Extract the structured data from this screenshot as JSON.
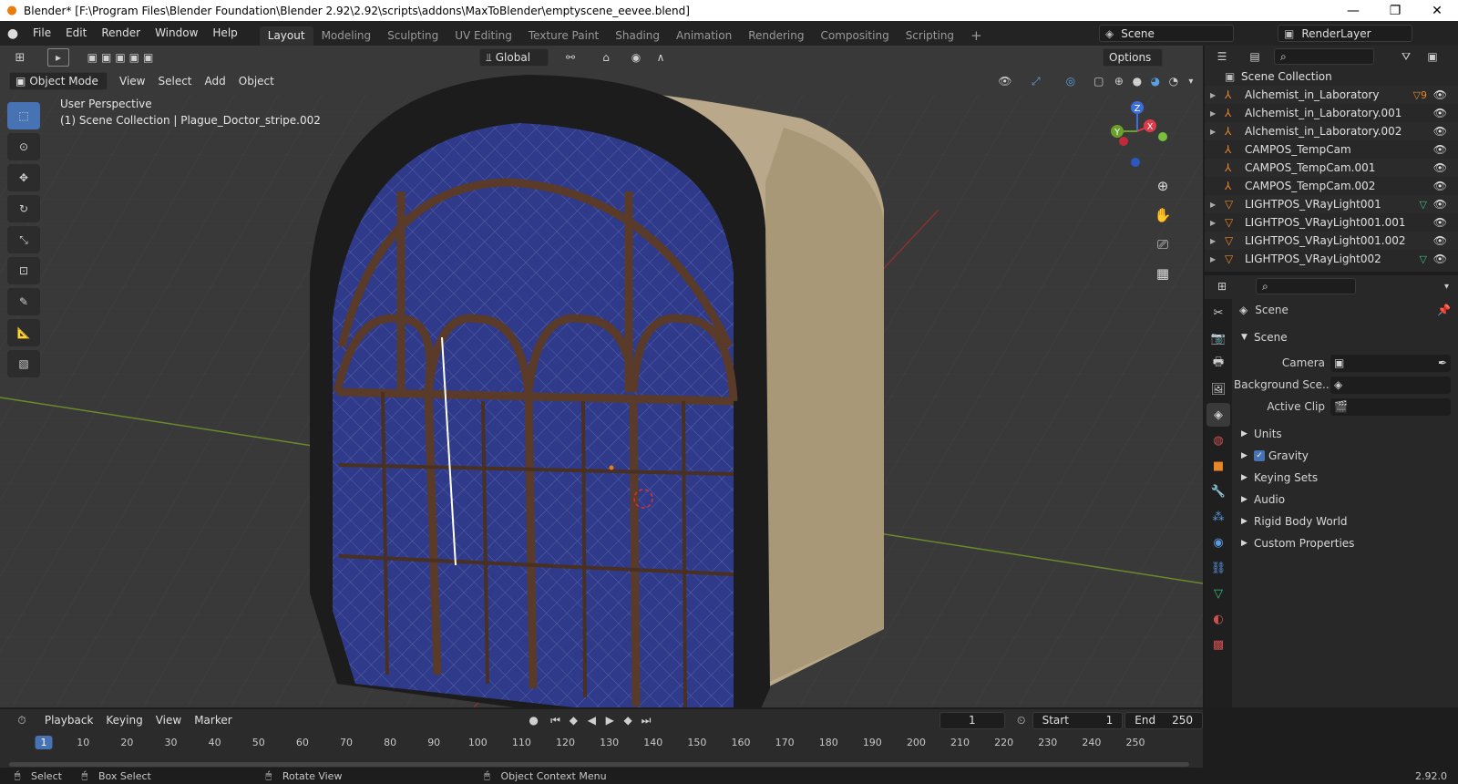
{
  "window": {
    "title": "Blender* [F:\\Program Files\\Blender Foundation\\Blender 2.92\\2.92\\scripts\\addons\\MaxToBlender\\emptyscene_eevee.blend]",
    "min": "—",
    "max": "❐",
    "close": "✕"
  },
  "menu": [
    "File",
    "Edit",
    "Render",
    "Window",
    "Help"
  ],
  "workspaces": [
    "Layout",
    "Modeling",
    "Sculpting",
    "UV Editing",
    "Texture Paint",
    "Shading",
    "Animation",
    "Rendering",
    "Compositing",
    "Scripting"
  ],
  "scene_selector": "Scene",
  "view_layer": "RenderLayer",
  "viewport": {
    "transform_orientation": "Global",
    "options": "Options",
    "mode": "Object Mode",
    "menus": [
      "View",
      "Select",
      "Add",
      "Object"
    ],
    "info_line1": "User Perspective",
    "info_line2": "(1) Scene Collection | Plague_Doctor_stripe.002",
    "gizmo": {
      "z": "Z",
      "y": "Y",
      "x": "X"
    }
  },
  "outliner": {
    "root": "Scene Collection",
    "items": [
      {
        "name": "Alchemist_in_Laboratory",
        "icon": "empty-icon",
        "expand": true,
        "extra": "9"
      },
      {
        "name": "Alchemist_in_Laboratory.001",
        "icon": "empty-icon",
        "expand": true,
        "extra": ""
      },
      {
        "name": "Alchemist_in_Laboratory.002",
        "icon": "empty-icon",
        "expand": true,
        "extra": ""
      },
      {
        "name": "CAMPOS_TempCam",
        "icon": "empty-icon",
        "expand": false,
        "extra": ""
      },
      {
        "name": "CAMPOS_TempCam.001",
        "icon": "empty-icon",
        "expand": false,
        "extra": ""
      },
      {
        "name": "CAMPOS_TempCam.002",
        "icon": "empty-icon",
        "expand": false,
        "extra": ""
      },
      {
        "name": "LIGHTPOS_VRayLight001",
        "icon": "mesh-icon",
        "expand": true,
        "extra": "mesh"
      },
      {
        "name": "LIGHTPOS_VRayLight001.001",
        "icon": "mesh-icon",
        "expand": true,
        "extra": ""
      },
      {
        "name": "LIGHTPOS_VRayLight001.002",
        "icon": "mesh-icon",
        "expand": true,
        "extra": ""
      },
      {
        "name": "LIGHTPOS_VRayLight002",
        "icon": "mesh-icon",
        "expand": true,
        "extra": "mesh"
      }
    ]
  },
  "properties": {
    "context": "Scene",
    "panel": "Scene",
    "fields": [
      {
        "label": "Camera",
        "value": ""
      },
      {
        "label": "Background Sce...",
        "value": ""
      },
      {
        "label": "Active Clip",
        "value": ""
      }
    ],
    "subpanels": [
      "Units",
      "Gravity",
      "Keying Sets",
      "Audio",
      "Rigid Body World",
      "Custom Properties"
    ],
    "gravity_checked": true
  },
  "timeline": {
    "menus": [
      "Playback",
      "Keying",
      "View",
      "Marker"
    ],
    "current_frame": "1",
    "start_label": "Start",
    "start": "1",
    "end_label": "End",
    "end": "250",
    "frames": [
      "1",
      "10",
      "20",
      "30",
      "40",
      "50",
      "60",
      "70",
      "80",
      "90",
      "100",
      "110",
      "120",
      "130",
      "140",
      "150",
      "160",
      "170",
      "180",
      "190",
      "200",
      "210",
      "220",
      "230",
      "240",
      "250"
    ]
  },
  "status": {
    "select": "Select",
    "box_select": "Box Select",
    "rotate": "Rotate View",
    "context_menu": "Object Context Menu",
    "version": "2.92.0"
  },
  "colors": {
    "accent": "#4772b3",
    "object_orange": "#e87d0d"
  }
}
